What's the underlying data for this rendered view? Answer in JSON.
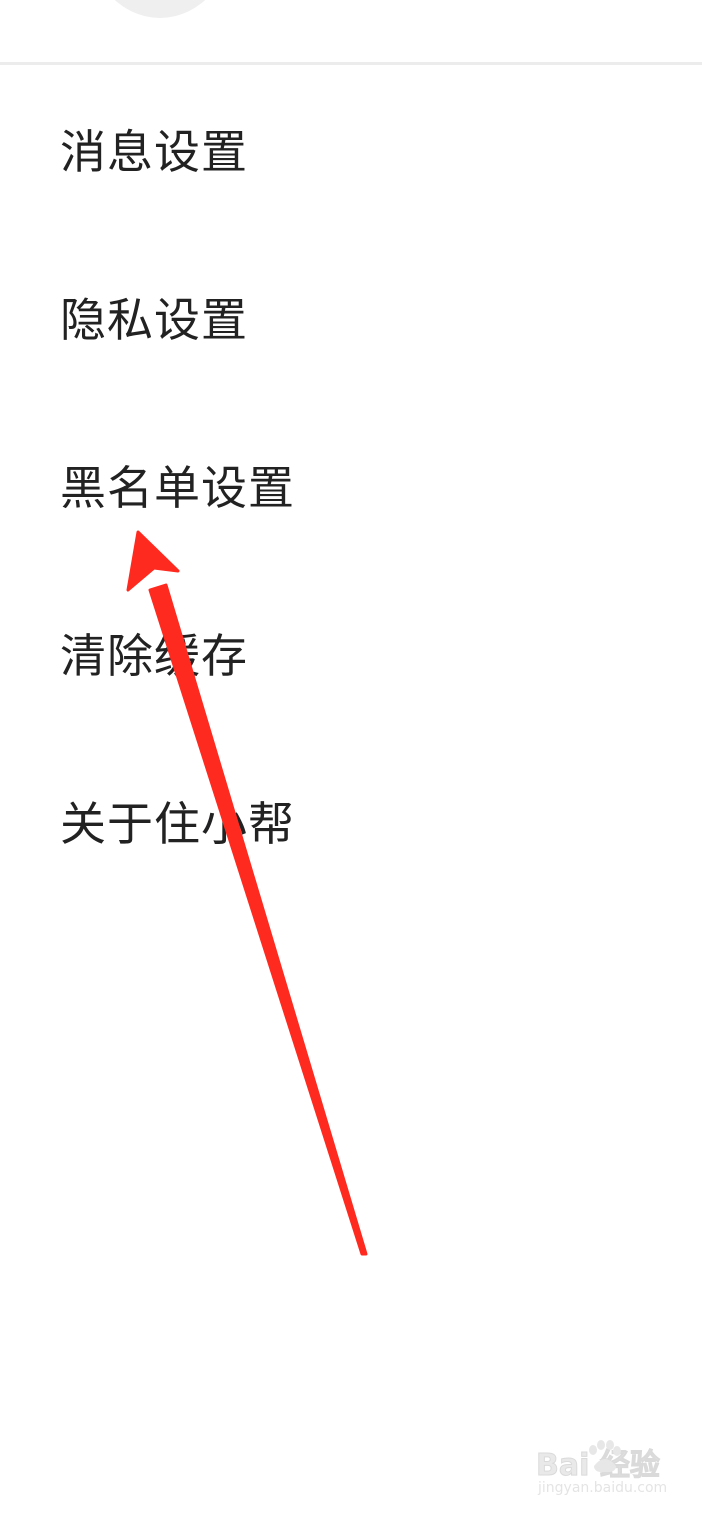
{
  "menu": {
    "items": [
      {
        "label": "消息设置"
      },
      {
        "label": "隐私设置"
      },
      {
        "label": "黑名单设置"
      },
      {
        "label": "清除缓存"
      },
      {
        "label": "关于住小帮"
      }
    ]
  },
  "annotation": {
    "arrow_color": "#ff2a1f",
    "points_to": "黑名单设置"
  },
  "watermark": {
    "logo": "Bai 经验",
    "url": "jingyan.baidu.com"
  },
  "colors": {
    "background": "#ffffff",
    "text": "#222222",
    "divider": "#ececec"
  }
}
